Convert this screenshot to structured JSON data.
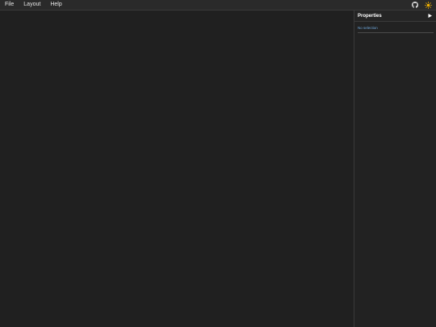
{
  "menubar": {
    "items": [
      {
        "label": "File"
      },
      {
        "label": "Layout"
      },
      {
        "label": "Help"
      }
    ],
    "icons": [
      "github-icon",
      "sun-icon"
    ],
    "theme_accent": "#f5b400"
  },
  "properties_panel": {
    "title": "Properties",
    "collapse_icon": "triangle-right-icon",
    "empty_message": "No selection"
  }
}
